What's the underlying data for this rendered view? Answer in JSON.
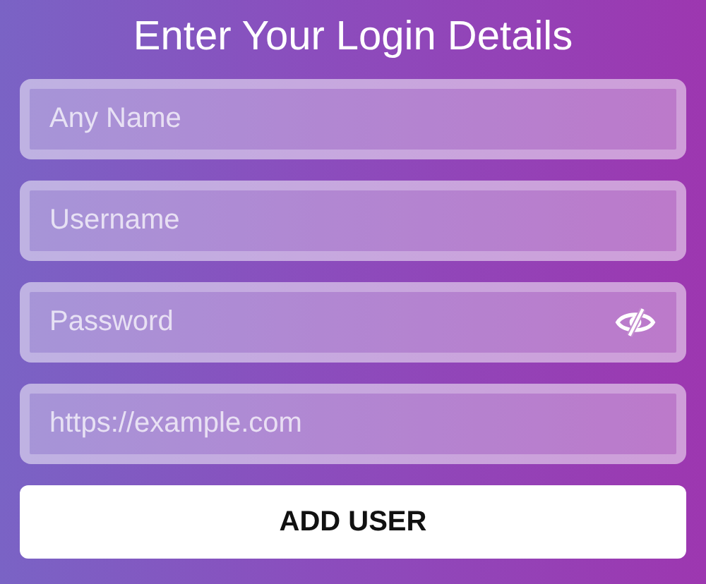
{
  "title": "Enter Your Login Details",
  "fields": [
    {
      "kind": "text",
      "placeholder": "Any Name"
    },
    {
      "kind": "text",
      "placeholder": "Username"
    },
    {
      "kind": "password",
      "placeholder": "Password"
    },
    {
      "kind": "url",
      "placeholder": "https://example.com"
    }
  ],
  "button": "ADD USER"
}
